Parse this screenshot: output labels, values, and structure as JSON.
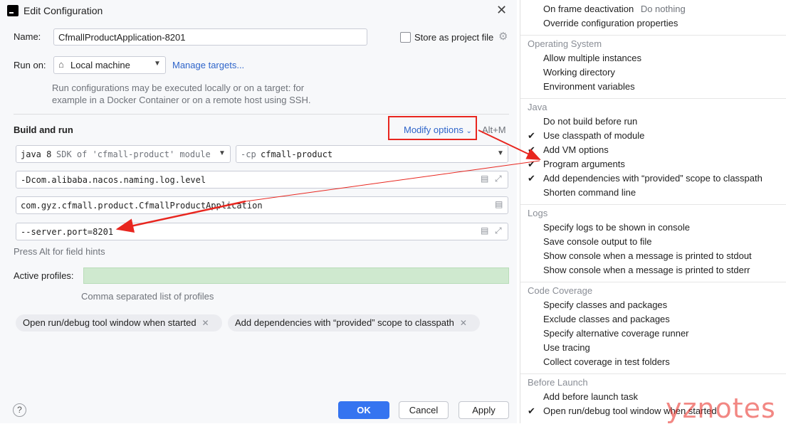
{
  "window": {
    "title": "Edit Configuration"
  },
  "form": {
    "name_label": "Name:",
    "name_value": "CfmallProductApplication-8201",
    "store_label": "Store as project file",
    "run_on_label": "Run on:",
    "run_on_value": "Local machine",
    "manage_targets": "Manage targets...",
    "run_note_1": "Run configurations may be executed locally or on a target: for",
    "run_note_2": "example in a Docker Container or on a remote host using SSH."
  },
  "build": {
    "title": "Build and run",
    "modify_options": "Modify options",
    "modify_shortcut": "Alt+M",
    "sdk_value": "java 8",
    "sdk_detail": "SDK of 'cfmall-product' module",
    "cp_prefix": "-cp",
    "cp_value": "cfmall-product",
    "vm_options": "-Dcom.alibaba.nacos.naming.log.level",
    "main_class": "com.gyz.cfmall.product.CfmallProductApplication",
    "program_args": "--server.port=8201",
    "field_hint": "Press Alt for field hints",
    "profiles_label": "Active profiles:",
    "profiles_hint": "Comma separated list of profiles"
  },
  "chips": [
    {
      "label": "Open run/debug tool window when started"
    },
    {
      "label": "Add dependencies with “provided” scope to classpath"
    }
  ],
  "footer": {
    "ok": "OK",
    "cancel": "Cancel",
    "apply": "Apply",
    "help": "?"
  },
  "menu": {
    "top": [
      {
        "label": "On frame deactivation",
        "value": "Do nothing"
      },
      {
        "label": "Override configuration properties"
      }
    ],
    "os_title": "Operating System",
    "os": [
      "Allow multiple instances",
      "Working directory",
      "Environment variables"
    ],
    "java_title": "Java",
    "java": [
      {
        "label": "Do not build before run",
        "checked": false
      },
      {
        "label": "Use classpath of module",
        "checked": true
      },
      {
        "label": "Add VM options",
        "checked": true
      },
      {
        "label": "Program arguments",
        "checked": true
      },
      {
        "label": "Add dependencies with “provided” scope to classpath",
        "checked": true
      },
      {
        "label": "Shorten command line",
        "checked": false
      }
    ],
    "logs_title": "Logs",
    "logs": [
      "Specify logs to be shown in console",
      "Save console output to file",
      "Show console when a message is printed to stdout",
      "Show console when a message is printed to stderr"
    ],
    "coverage_title": "Code Coverage",
    "coverage": [
      "Specify classes and packages",
      "Exclude classes and packages",
      "Specify alternative coverage runner",
      "Use tracing",
      "Collect coverage in test folders"
    ],
    "before_title": "Before Launch",
    "before": [
      {
        "label": "Add before launch task",
        "checked": false
      },
      {
        "label": "Open run/debug tool window when started",
        "checked": true
      }
    ]
  },
  "watermark": "yznotes",
  "colors": {
    "accent": "#3574f0",
    "annotation": "#e8261f",
    "profiles_bg": "#cfe9cf"
  }
}
